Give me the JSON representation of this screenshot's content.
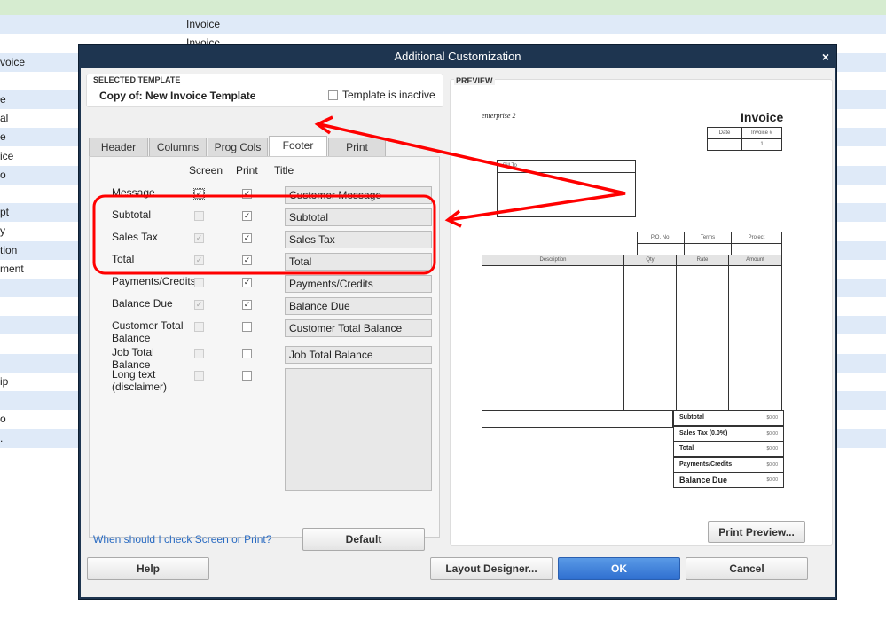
{
  "background": {
    "left_fragments": [
      "voice",
      "e",
      "al",
      "e",
      "ice",
      "o",
      "pt",
      "y",
      "tion",
      "ment",
      "ip",
      "o",
      "."
    ],
    "right_items": [
      "Invoice",
      "Invoice"
    ]
  },
  "dialog": {
    "title": "Additional Customization",
    "close": "×",
    "selected_template": {
      "caption": "SELECTED TEMPLATE",
      "name": "Copy of: New Invoice Template",
      "inactive_label": "Template is inactive",
      "inactive": false
    },
    "tabs": [
      {
        "label": "Header"
      },
      {
        "label": "Columns"
      },
      {
        "label": "Prog Cols"
      },
      {
        "label": "Footer",
        "active": true
      },
      {
        "label": "Print"
      }
    ],
    "columns": {
      "screen": "Screen",
      "print": "Print",
      "title": "Title"
    },
    "rows": [
      {
        "label": "Message",
        "screen": true,
        "print": true,
        "title": "Customer Message"
      },
      {
        "label": "Subtotal",
        "screen": false,
        "print": true,
        "title": "Subtotal"
      },
      {
        "label": "Sales Tax",
        "screen": true,
        "print": true,
        "title": "Sales Tax"
      },
      {
        "label": "Total",
        "screen": true,
        "print": true,
        "title": "Total"
      },
      {
        "label": "Payments/Credits",
        "screen": false,
        "print": true,
        "title": "Payments/Credits"
      },
      {
        "label": "Balance Due",
        "screen": true,
        "print": true,
        "title": "Balance Due"
      },
      {
        "label": "Customer Total Balance",
        "screen": false,
        "print": false,
        "title": "Customer Total Balance"
      },
      {
        "label": "Job Total Balance",
        "screen": false,
        "print": false,
        "title": "Job Total Balance"
      },
      {
        "label": "Long text (disclaimer)",
        "screen": false,
        "print": false,
        "title": ""
      }
    ],
    "help_link": "When should I check Screen or Print?",
    "default_btn": "Default",
    "preview": {
      "caption": "PREVIEW",
      "company": "enterprise 2",
      "heading": "Invoice",
      "date_hdr": "Date",
      "invno_hdr": "Invoice #",
      "invno": "1",
      "bill_to": "Bill To",
      "po": "P.O. No.",
      "terms": "Terms",
      "project": "Project",
      "cols": [
        "Description",
        "Qty",
        "Rate",
        "Amount"
      ],
      "totals": [
        {
          "label": "Subtotal",
          "value": "$0.00"
        },
        {
          "label": "Sales Tax  (0.0%)",
          "value": "$0.00"
        },
        {
          "label": "Total",
          "value": "$0.00"
        },
        {
          "label": "Payments/Credits",
          "value": "$0.00"
        },
        {
          "label": "Balance Due",
          "value": "$0.00"
        }
      ]
    },
    "print_preview": "Print Preview...",
    "help": "Help",
    "layout_designer": "Layout Designer...",
    "ok": "OK",
    "cancel": "Cancel"
  },
  "colors": {
    "annotation": "#ff0000",
    "title_bar": "#1e3550",
    "row_alt": "#dfeaf8"
  }
}
